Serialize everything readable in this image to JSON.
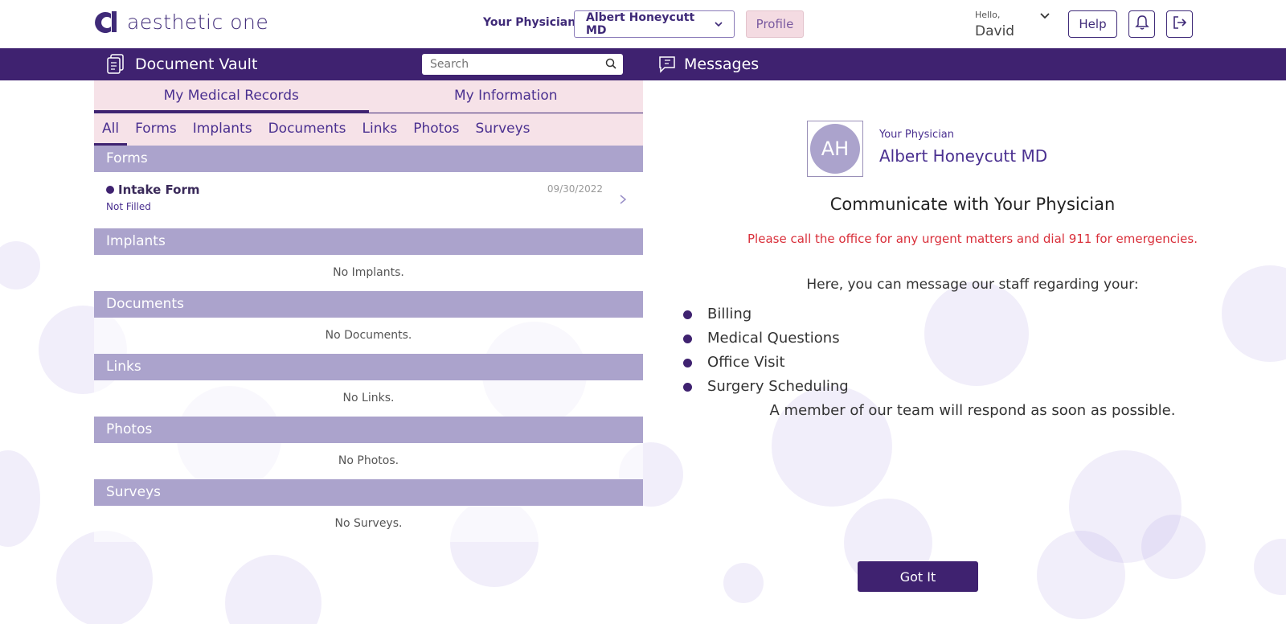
{
  "header": {
    "logo_text": "aesthetic one",
    "physician_label": "Your Physician",
    "physician_selected": "Albert Honeycutt MD",
    "profile_label": "Profile",
    "hello": "Hello,",
    "user_name": "David",
    "help_label": "Help"
  },
  "topbar": {
    "vault_title": "Document Vault",
    "search_placeholder": "Search",
    "messages_title": "Messages"
  },
  "left": {
    "main_tabs": [
      "My Medical Records",
      "My Information"
    ],
    "sub_tabs": [
      "All",
      "Forms",
      "Implants",
      "Documents",
      "Links",
      "Photos",
      "Surveys"
    ],
    "sections": {
      "forms": {
        "title": "Forms",
        "item_name": "Intake Form",
        "item_status": "Not Filled",
        "item_date": "09/30/2022"
      },
      "implants": {
        "title": "Implants",
        "empty": "No Implants."
      },
      "documents": {
        "title": "Documents",
        "empty": "No Documents."
      },
      "links": {
        "title": "Links",
        "empty": "No Links."
      },
      "photos": {
        "title": "Photos",
        "empty": "No Photos."
      },
      "surveys": {
        "title": "Surveys",
        "empty": "No Surveys."
      }
    }
  },
  "right": {
    "avatar_initials": "AH",
    "physician_label": "Your Physician",
    "physician_name": "Albert Honeycutt MD",
    "title": "Communicate with Your Physician",
    "warning": "Please call the office for any urgent matters and dial 911 for emergencies.",
    "intro": "Here, you can message our staff regarding your:",
    "topics": [
      "Billing",
      "Medical Questions",
      "Office Visit",
      "Surgery Scheduling"
    ],
    "note": "A member of our team will respond as soon as possible.",
    "button_label": "Got It"
  },
  "colors": {
    "brand": "#3f2270",
    "section_header": "#aba3cc",
    "tab_background": "#f6e2e8",
    "warning": "#d92f3a"
  }
}
